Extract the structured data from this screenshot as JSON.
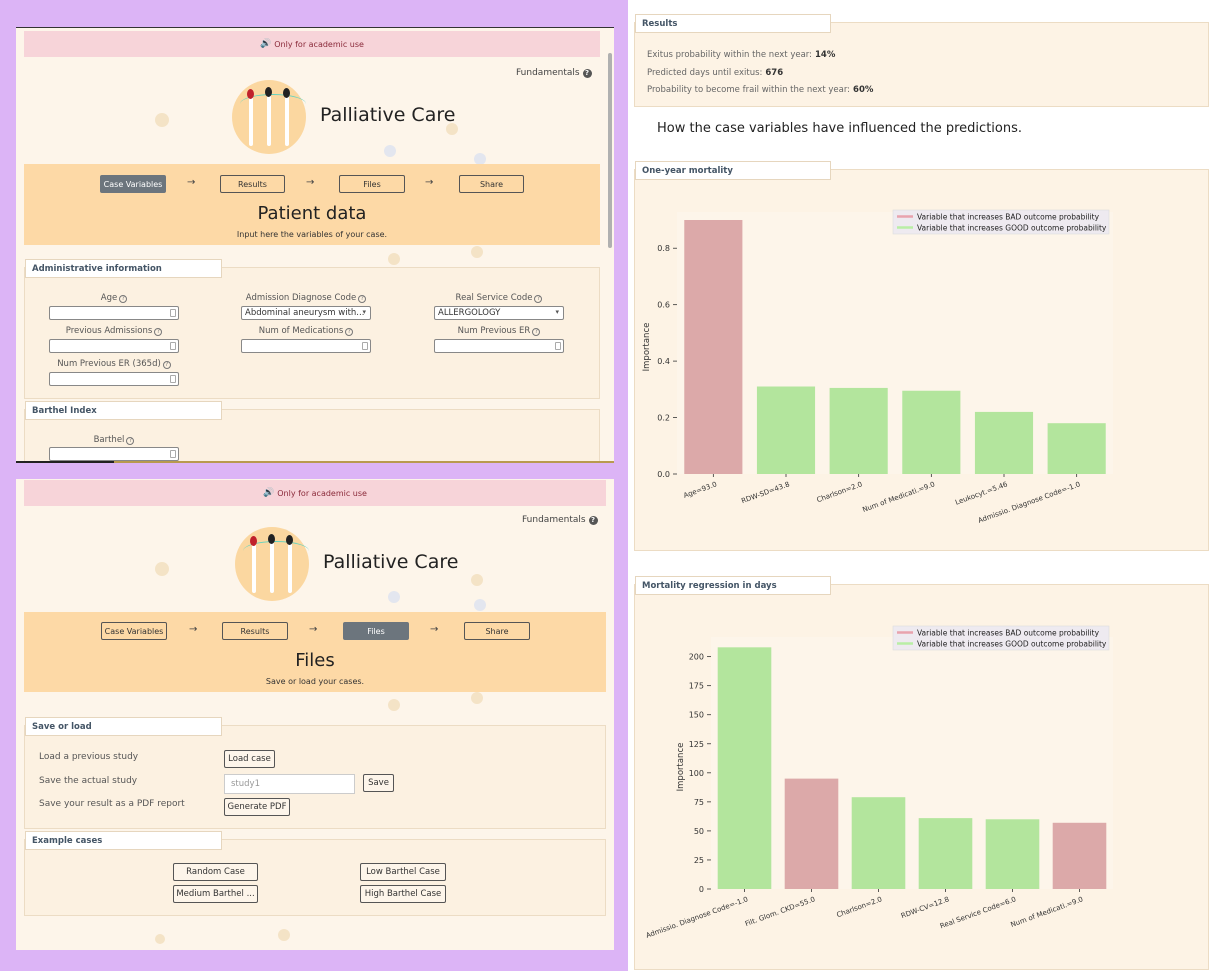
{
  "banner": {
    "text": "Only for academic use"
  },
  "fundamentals": "Fundamentals",
  "app": {
    "title": "Palliative Care"
  },
  "steps": [
    "Case Variables",
    "Results",
    "Files",
    "Share"
  ],
  "patient": {
    "title": "Patient data",
    "subtitle": "Input here the variables of your case.",
    "admin_section": "Administrative information",
    "fields": {
      "age": "Age",
      "admission_code": "Admission Diagnose Code",
      "admission_code_value": "Abdominal aneurysm with...",
      "real_service": "Real Service Code",
      "real_service_value": "ALLERGOLOGY",
      "prev_admissions": "Previous Admissions",
      "num_medications": "Num of Medications",
      "num_prev_er": "Num Previous ER",
      "num_prev_er_365": "Num Previous ER (365d)"
    },
    "barthel_section": "Barthel Index",
    "barthel_label": "Barthel"
  },
  "files": {
    "title": "Files",
    "subtitle": "Save or load your cases.",
    "save_section": "Save or load",
    "load_label": "Load a previous study",
    "load_btn": "Load case",
    "save_label": "Save the actual study",
    "save_value": "study1",
    "save_btn": "Save",
    "pdf_label": "Save your result as a PDF report",
    "pdf_btn": "Generate PDF",
    "examples_section": "Example cases",
    "examples": [
      "Random Case",
      "Low Barthel Case",
      "Medium Barthel ...",
      "High Barthel Case"
    ]
  },
  "results": {
    "title": "Results",
    "lines": [
      {
        "label": "Exitus probability within the next year:",
        "value": "14%"
      },
      {
        "label": "Predicted days until exitus:",
        "value": "676"
      },
      {
        "label": "Probability to become frail within the next year:",
        "value": "60%"
      }
    ],
    "explain": "How the case variables have influenced the predictions."
  },
  "colors": {
    "bad": "#dca9a9",
    "good": "#b3e59d",
    "bad_legend": "#e8a3ad",
    "good_legend": "#b9eea5"
  },
  "chart_data": [
    {
      "type": "bar",
      "title": "One-year mortality",
      "ylabel": "Importance",
      "ylim": [
        0,
        0.9
      ],
      "yticks": [
        "0.0",
        "0.2",
        "0.4",
        "0.6",
        "0.8"
      ],
      "ytick_values": [
        0,
        0.2,
        0.4,
        0.6,
        0.8
      ],
      "legend": [
        "Variable that increases BAD outcome probability",
        "Variable that increases GOOD outcome probability"
      ],
      "categories": [
        "Age=93.0",
        "RDW-SD=43.8",
        "Charlson=2.0",
        "Num of Medicati.=9.0",
        "Leukocyt.=5.46",
        "Admissio. Diagnose Code=-1.0"
      ],
      "values": [
        0.9,
        0.31,
        0.305,
        0.295,
        0.22,
        0.18
      ],
      "effect": [
        "bad",
        "good",
        "good",
        "good",
        "good",
        "good"
      ]
    },
    {
      "type": "bar",
      "title": "Mortality regression in days",
      "ylabel": "Importance",
      "ylim": [
        0,
        210
      ],
      "yticks": [
        "0",
        "25",
        "50",
        "75",
        "100",
        "125",
        "150",
        "175",
        "200"
      ],
      "ytick_values": [
        0,
        25,
        50,
        75,
        100,
        125,
        150,
        175,
        200
      ],
      "legend": [
        "Variable that increases BAD outcome probability",
        "Variable that increases GOOD outcome probability"
      ],
      "categories": [
        "Admissio. Diagnose Code=-1.0",
        "Filt. Glom. CKD=55.0",
        "Charlson=2.0",
        "RDW-CV=12.8",
        "Real Service Code=6.0",
        "Num of Medicati.=9.0"
      ],
      "values": [
        208,
        95,
        79,
        61,
        60,
        57
      ],
      "effect": [
        "good",
        "bad",
        "good",
        "good",
        "good",
        "bad"
      ]
    }
  ]
}
